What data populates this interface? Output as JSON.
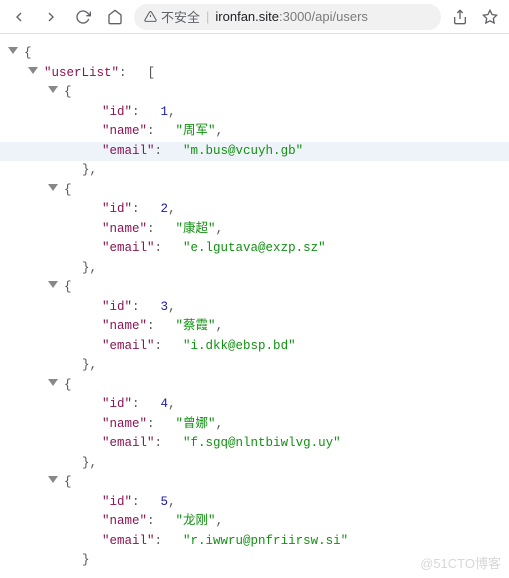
{
  "toolbar": {
    "insecure_label": "不安全",
    "url_host": "ironfan.site",
    "url_port": ":3000",
    "url_path": "/api/users"
  },
  "json": {
    "root_key": "userList",
    "id_key": "id",
    "name_key": "name",
    "email_key": "email",
    "users": [
      {
        "id": 1,
        "name": "周军",
        "email": "m.bus@vcuyh.gb"
      },
      {
        "id": 2,
        "name": "康超",
        "email": "e.lgutava@exzp.sz"
      },
      {
        "id": 3,
        "name": "蔡霞",
        "email": "i.dkk@ebsp.bd"
      },
      {
        "id": 4,
        "name": "曾娜",
        "email": "f.sgq@nlntbiwlvg.uy"
      },
      {
        "id": 5,
        "name": "龙刚",
        "email": "r.iwwru@pnfriirsw.si"
      }
    ]
  },
  "watermark": "@51CTO博客"
}
